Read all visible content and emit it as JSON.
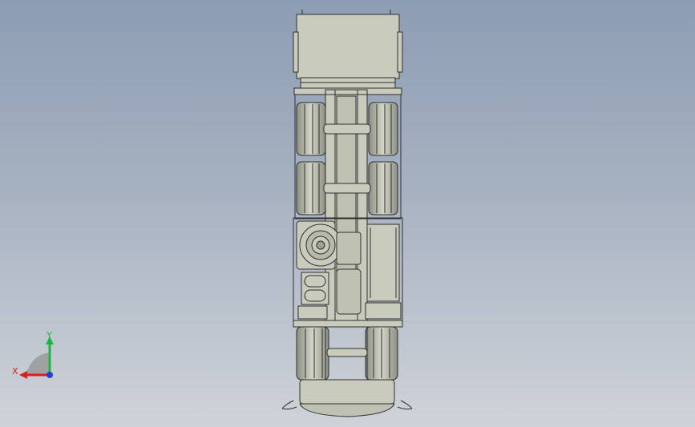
{
  "viewport": {
    "background_top": "#8d9db4",
    "background_bottom": "#cfd3d9",
    "model_fill": "#c9cbbc",
    "model_fill_dark": "#a9ab9d",
    "model_edge": "#2f2f2f"
  },
  "triad": {
    "x_label": "X",
    "y_label": "Y",
    "x_color": "#d81e1e",
    "y_color": "#19b83a",
    "z_color": "#1f3fd6"
  }
}
